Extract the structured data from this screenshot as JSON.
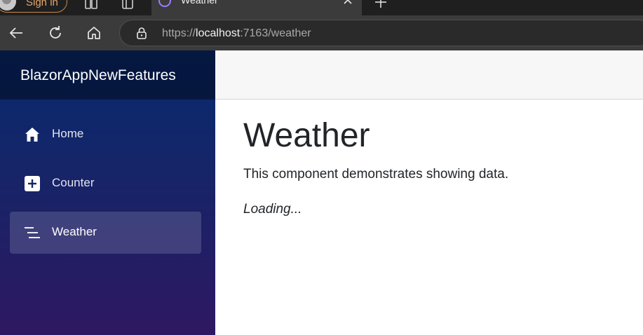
{
  "browser": {
    "signin_label": "Sign in",
    "tab": {
      "title": "Weather"
    },
    "address": {
      "scheme": "https://",
      "host": "localhost",
      "rest": ":7163/weather"
    },
    "icons": {
      "workspaces": "workspaces-icon",
      "tab_actions": "tab-actions-icon",
      "tab_favicon": "blazor-favicon-icon",
      "tab_close": "close-icon",
      "new_tab": "plus-icon",
      "back": "back-arrow-icon",
      "refresh": "refresh-icon",
      "home": "home-icon",
      "lock": "lock-icon"
    }
  },
  "sidebar": {
    "brand": "BlazorAppNewFeatures",
    "items": [
      {
        "label": "Home",
        "icon": "house-icon",
        "active": false
      },
      {
        "label": "Counter",
        "icon": "plus-square-icon",
        "active": false
      },
      {
        "label": "Weather",
        "icon": "list-icon",
        "active": true
      }
    ]
  },
  "main": {
    "title": "Weather",
    "description": "This component demonstrates showing data.",
    "loading": "Loading..."
  },
  "colors": {
    "sidebar_top": "#072a6f",
    "sidebar_bottom": "#2e1862",
    "active_item": "rgba(255,255,255,0.15)",
    "text": "#212529",
    "signin_accent": "#e6a66a"
  }
}
